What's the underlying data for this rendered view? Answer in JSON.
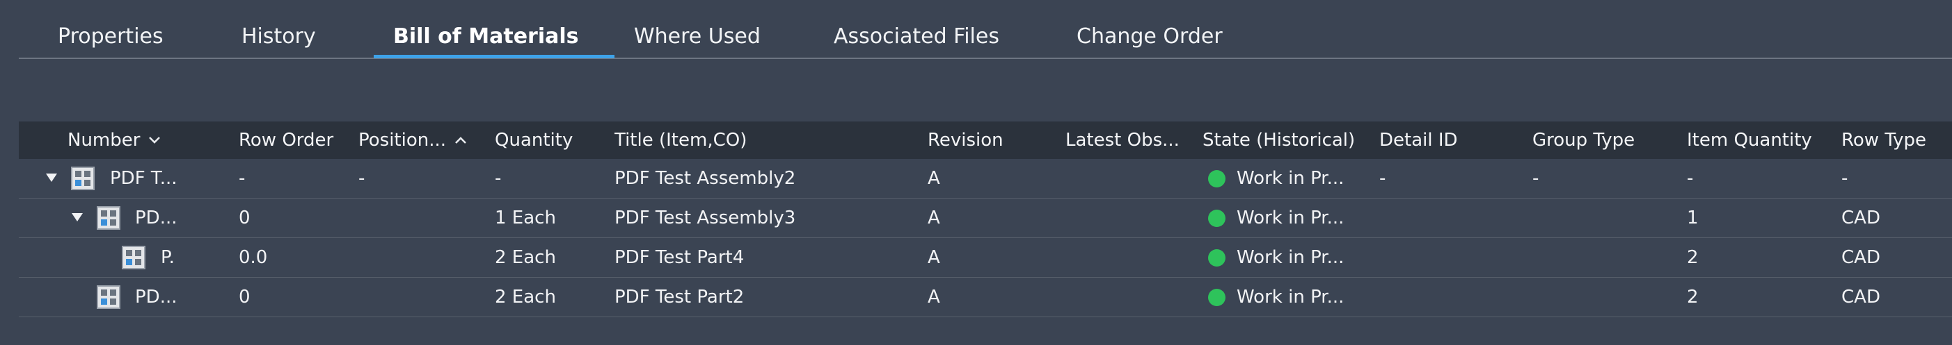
{
  "tabs": [
    {
      "label": "Properties"
    },
    {
      "label": "History"
    },
    {
      "label": "Bill of Materials"
    },
    {
      "label": "Where Used"
    },
    {
      "label": "Associated Files"
    },
    {
      "label": "Change Order"
    }
  ],
  "active_tab": "Bill of Materials",
  "columns": {
    "number": "Number",
    "row_order": "Row Order",
    "position": "Position...",
    "quantity": "Quantity",
    "title": "Title (Item,CO)",
    "revision": "Revision",
    "latest_obs": "Latest Obs...",
    "state": "State (Historical)",
    "detail_id": "Detail ID",
    "group_type": "Group Type",
    "item_quantity": "Item Quantity",
    "row_type": "Row Type"
  },
  "sort": {
    "number": "chevron-down",
    "position": "chevron-up"
  },
  "rows": [
    {
      "number": "PDF T...",
      "row_order": "-",
      "position": "-",
      "quantity": "-",
      "title": "PDF Test Assembly2",
      "revision": "A",
      "latest_obs": "",
      "state": "Work in Pr...",
      "detail_id": "-",
      "group_type": "-",
      "item_quantity": "-",
      "row_type": "-",
      "expanded": true,
      "level": 0
    },
    {
      "number": "PD...",
      "row_order": "0",
      "position": "",
      "quantity": "1 Each",
      "title": "PDF Test Assembly3",
      "revision": "A",
      "latest_obs": "",
      "state": "Work in Pr...",
      "detail_id": "",
      "group_type": "",
      "item_quantity": "1",
      "row_type": "CAD",
      "expanded": true,
      "level": 1
    },
    {
      "number": "P.",
      "row_order": "0.0",
      "position": "",
      "quantity": "2 Each",
      "title": "PDF Test Part4",
      "revision": "A",
      "latest_obs": "",
      "state": "Work in Pr...",
      "detail_id": "",
      "group_type": "",
      "item_quantity": "2",
      "row_type": "CAD",
      "expanded": null,
      "level": 2
    },
    {
      "number": "PD...",
      "row_order": "0",
      "position": "",
      "quantity": "2 Each",
      "title": "PDF Test Part2",
      "revision": "A",
      "latest_obs": "",
      "state": "Work in Pr...",
      "detail_id": "",
      "group_type": "",
      "item_quantity": "2",
      "row_type": "CAD",
      "expanded": null,
      "level": 1
    }
  ],
  "colors": {
    "background": "#3b4453",
    "header_background": "#2b323c",
    "accent": "#3ea2e8",
    "state_work_in_progress": "#2ec35b"
  },
  "icons": {
    "item": "assembly-item-icon",
    "expand": "triangle-down-icon",
    "state": "status-dot-icon"
  }
}
